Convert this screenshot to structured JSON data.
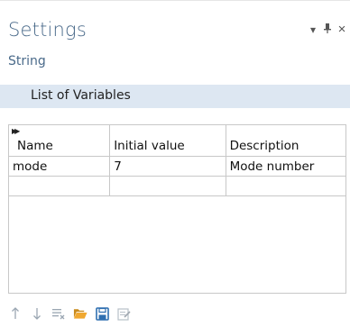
{
  "panel": {
    "title": "Settings",
    "subtitle": "String",
    "controls": {
      "menu_glyph": "▾",
      "pin_glyph": "⊥",
      "close_glyph": "×"
    }
  },
  "section": {
    "label": "List of Variables"
  },
  "table": {
    "columns": [
      "Name",
      "Initial value",
      "Description"
    ],
    "rows": [
      {
        "name": "mode",
        "initial_value": "7",
        "description": "Mode number"
      },
      {
        "name": "",
        "initial_value": "",
        "description": ""
      }
    ]
  },
  "toolbar": {
    "icons": [
      "move-up-icon",
      "move-down-icon",
      "delete-icon",
      "load-from-file-icon",
      "save-to-file-icon",
      "edit-icon"
    ]
  },
  "colors": {
    "title": "#4a6a8a",
    "section_bg": "#dde7f2",
    "grid": "#c8c8c8",
    "folder": "#e8a22c",
    "save": "#2f6fb0"
  }
}
